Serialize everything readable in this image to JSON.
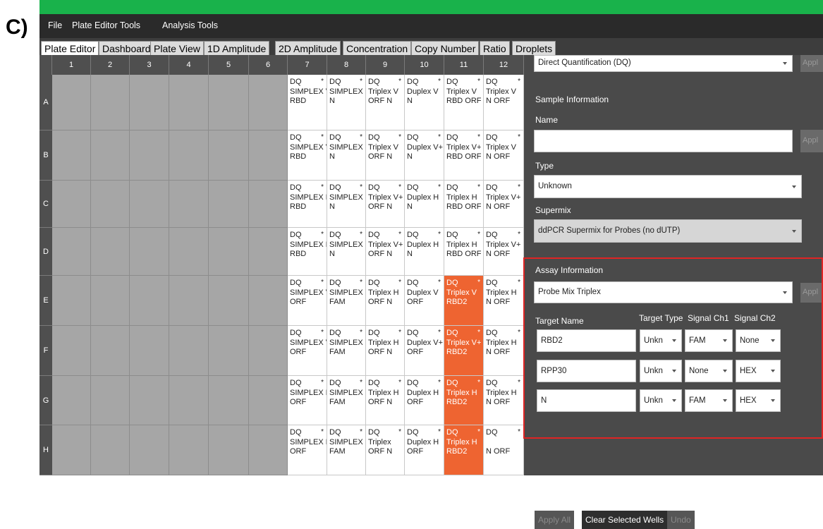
{
  "panel_label": "C)",
  "menu": [
    "File",
    "Plate Editor Tools",
    "Analysis Tools"
  ],
  "tabs": [
    "Plate Editor",
    "Dashboard",
    "Plate View",
    "1D Amplitude",
    "2D Amplitude",
    "Concentration",
    "Copy Number",
    "Ratio",
    "Droplets"
  ],
  "active_tab": "Plate Editor",
  "columns": [
    "1",
    "2",
    "3",
    "4",
    "5",
    "6",
    "7",
    "8",
    "9",
    "10",
    "11",
    "12"
  ],
  "rows": [
    "A",
    "B",
    "C",
    "D",
    "E",
    "F",
    "G",
    "H"
  ],
  "wells": {
    "A": [
      [
        "DQ",
        "SIMPLEX V",
        "RBD"
      ],
      [
        "DQ",
        "SIMPLEX V",
        "N"
      ],
      [
        "DQ",
        "Triplex V",
        "ORF N"
      ],
      [
        "DQ",
        "Duplex V",
        "N"
      ],
      [
        "DQ",
        "Triplex V",
        "RBD ORF"
      ],
      [
        "DQ",
        "Triplex V",
        "N ORF"
      ]
    ],
    "B": [
      [
        "DQ",
        "SIMPLEX V",
        "RBD"
      ],
      [
        "DQ",
        "SIMPLEX V",
        "N"
      ],
      [
        "DQ",
        "Triplex V",
        "ORF N"
      ],
      [
        "DQ",
        "Duplex V+",
        "N"
      ],
      [
        "DQ",
        "Triplex V+",
        "RBD ORF"
      ],
      [
        "DQ",
        "Triplex V",
        "N ORF"
      ]
    ],
    "C": [
      [
        "DQ",
        "SIMPLEX H",
        "RBD"
      ],
      [
        "DQ",
        "SIMPLEX H",
        "N"
      ],
      [
        "DQ",
        "Triplex V+",
        "ORF N"
      ],
      [
        "DQ",
        "Duplex H",
        "N"
      ],
      [
        "DQ",
        "Triplex H",
        "RBD ORF"
      ],
      [
        "DQ",
        "Triplex V+",
        "N ORF"
      ]
    ],
    "D": [
      [
        "DQ",
        "SIMPLEX H",
        "RBD"
      ],
      [
        "DQ",
        "SIMPLEX V",
        "N"
      ],
      [
        "DQ",
        "Triplex V+",
        "ORF N"
      ],
      [
        "DQ",
        "Duplex H",
        "N"
      ],
      [
        "DQ",
        "Triplex H",
        "RBD ORF"
      ],
      [
        "DQ",
        "Triplex V+",
        "N ORF"
      ]
    ],
    "E": [
      [
        "DQ",
        "SIMPLEX V",
        "ORF"
      ],
      [
        "DQ",
        "SIMPLEX V",
        "FAM"
      ],
      [
        "DQ",
        "Triplex H",
        "ORF N"
      ],
      [
        "DQ",
        "Duplex V",
        "ORF"
      ],
      [
        "DQ",
        "Triplex V",
        "RBD2"
      ],
      [
        "DQ",
        "Triplex H",
        "N ORF"
      ]
    ],
    "F": [
      [
        "DQ",
        "SIMPLEX V",
        "ORF"
      ],
      [
        "DQ",
        "SIMPLEX V",
        "FAM"
      ],
      [
        "DQ",
        "Triplex H",
        "ORF N"
      ],
      [
        "DQ",
        "Duplex V+",
        "ORF"
      ],
      [
        "DQ",
        "Triplex V+",
        "RBD2"
      ],
      [
        "DQ",
        "Triplex H",
        "N ORF"
      ]
    ],
    "G": [
      [
        "DQ",
        "SIMPLEX H",
        "ORF"
      ],
      [
        "DQ",
        "SIMPLEX H",
        "FAM"
      ],
      [
        "DQ",
        "Triplex H",
        "ORF N"
      ],
      [
        "DQ",
        "Duplex H",
        "ORF"
      ],
      [
        "DQ",
        "Triplex H",
        "RBD2"
      ],
      [
        "DQ",
        "Triplex H",
        "N ORF"
      ]
    ],
    "H": [
      [
        "DQ",
        "SIMPLEX H",
        "ORF"
      ],
      [
        "DQ",
        "SIMPLEX",
        "FAM"
      ],
      [
        "DQ",
        "Triplex",
        "ORF N"
      ],
      [
        "DQ",
        "Duplex H",
        "ORF"
      ],
      [
        "DQ",
        "Triplex H",
        "RBD2"
      ],
      [
        "DQ",
        "",
        "N ORF"
      ]
    ]
  },
  "selected_wells": [
    "E11",
    "F11",
    "G11",
    "H11"
  ],
  "star": "*",
  "panel": {
    "experiment_type": "Direct Quantification (DQ)",
    "apply": "Appl",
    "sample_info_title": "Sample Information",
    "name_label": "Name",
    "name_value": "",
    "type_label": "Type",
    "type_value": "Unknown",
    "supermix_label": "Supermix",
    "supermix_value": "ddPCR Supermix for Probes (no dUTP)",
    "assay_info_title": "Assay Information",
    "assay_value": "Probe Mix Triplex",
    "target_headers": [
      "Target Name",
      "Target Type",
      "Signal Ch1",
      "Signal Ch2"
    ],
    "targets": [
      {
        "name": "RBD2",
        "type": "Unkn",
        "ch1": "FAM",
        "ch2": "None"
      },
      {
        "name": "RPP30",
        "type": "Unkn",
        "ch1": "None",
        "ch2": "HEX"
      },
      {
        "name": "N",
        "type": "Unkn",
        "ch1": "FAM",
        "ch2": "HEX"
      }
    ],
    "apply_all": "Apply All",
    "clear_selected": "Clear Selected Wells",
    "undo": "Undo"
  },
  "colors": {
    "accent_green": "#19b24b",
    "selected_well": "#ee6431",
    "highlight_box": "#e02424"
  }
}
